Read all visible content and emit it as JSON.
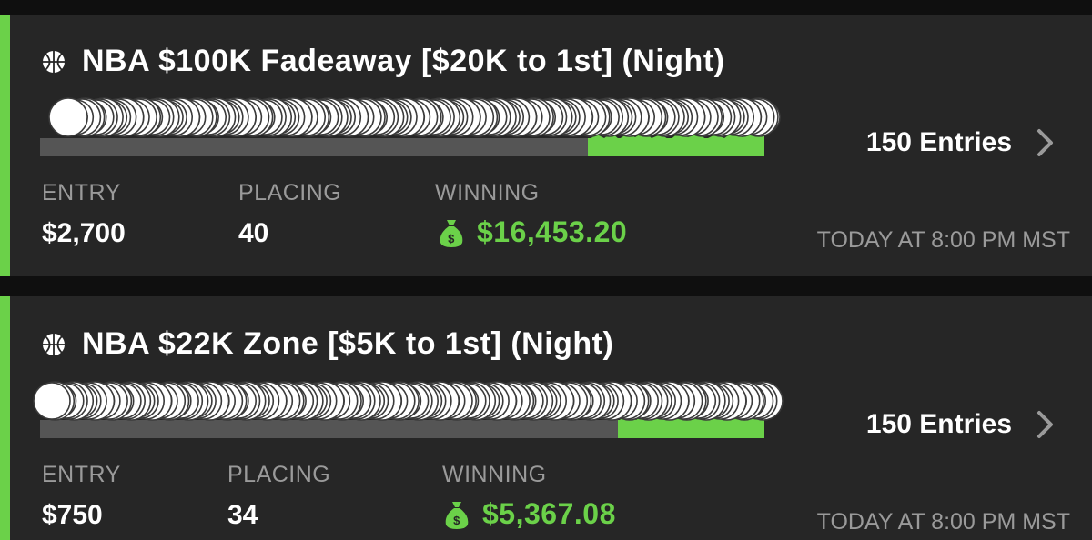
{
  "colors": {
    "accent": "#6bd149",
    "card": "#262626",
    "background": "#0f0f0f",
    "muted": "#9a9a9a"
  },
  "contests": [
    {
      "icon": "basketball-icon",
      "title": "NBA $100K Fadeaway [$20K to 1st] (Night)",
      "entries_label": "150 Entries",
      "entry_label": "ENTRY",
      "entry_value": "$2,700",
      "placing_label": "PLACING",
      "placing_value": "40",
      "winning_label": "WINNING",
      "winning_value": "$16,453.20",
      "time": "TODAY AT 8:00 PM MST",
      "winning_fraction": 0.24
    },
    {
      "icon": "basketball-icon",
      "title": "NBA $22K Zone [$5K to 1st] (Night)",
      "entries_label": "150 Entries",
      "entry_label": "ENTRY",
      "entry_value": "$750",
      "placing_label": "PLACING",
      "placing_value": "34",
      "winning_label": "WINNING",
      "winning_value": "$5,367.08",
      "time": "TODAY AT 8:00 PM MST",
      "winning_fraction": 0.2
    }
  ]
}
